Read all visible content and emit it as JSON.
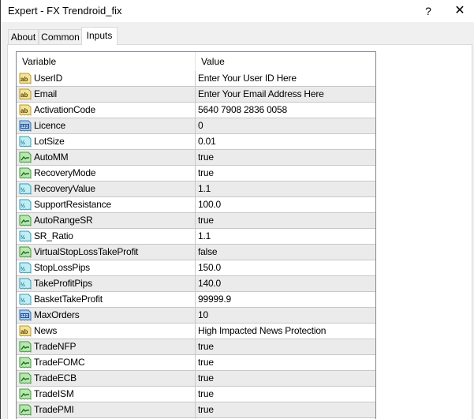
{
  "window": {
    "title": "Expert - FX Trendroid_fix",
    "help_label": "?",
    "close_label": "✕"
  },
  "tabs": [
    {
      "label": "About",
      "active": false
    },
    {
      "label": "Common",
      "active": false
    },
    {
      "label": "Inputs",
      "active": true
    }
  ],
  "grid": {
    "columns": {
      "variable": "Variable",
      "value": "Value"
    },
    "rows": [
      {
        "icon": "string-icon",
        "variable": "UserID",
        "value": "Enter Your User ID Here"
      },
      {
        "icon": "string-icon",
        "variable": "Email",
        "value": "Enter Your Email Address Here"
      },
      {
        "icon": "string-icon",
        "variable": "ActivationCode",
        "value": "5640 7908 2836 0058"
      },
      {
        "icon": "integer-icon",
        "variable": "Licence",
        "value": "0"
      },
      {
        "icon": "double-icon",
        "variable": "LotSize",
        "value": "0.01"
      },
      {
        "icon": "bool-icon",
        "variable": "AutoMM",
        "value": "true"
      },
      {
        "icon": "bool-icon",
        "variable": "RecoveryMode",
        "value": "true"
      },
      {
        "icon": "double-icon",
        "variable": "RecoveryValue",
        "value": "1.1"
      },
      {
        "icon": "double-icon",
        "variable": "SupportResistance",
        "value": "100.0"
      },
      {
        "icon": "bool-icon",
        "variable": "AutoRangeSR",
        "value": "true"
      },
      {
        "icon": "double-icon",
        "variable": "SR_Ratio",
        "value": "1.1"
      },
      {
        "icon": "bool-icon",
        "variable": "VirtualStopLossTakeProfit",
        "value": "false"
      },
      {
        "icon": "double-icon",
        "variable": "StopLossPips",
        "value": "150.0"
      },
      {
        "icon": "double-icon",
        "variable": "TakeProfitPips",
        "value": "140.0"
      },
      {
        "icon": "double-icon",
        "variable": "BasketTakeProfit",
        "value": "99999.9"
      },
      {
        "icon": "integer-icon",
        "variable": "MaxOrders",
        "value": "10"
      },
      {
        "icon": "string-icon",
        "variable": "News",
        "value": "High Impacted News Protection"
      },
      {
        "icon": "bool-icon",
        "variable": "TradeNFP",
        "value": "true"
      },
      {
        "icon": "bool-icon",
        "variable": "TradeFOMC",
        "value": "true"
      },
      {
        "icon": "bool-icon",
        "variable": "TradeECB",
        "value": "true"
      },
      {
        "icon": "bool-icon",
        "variable": "TradeISM",
        "value": "true"
      },
      {
        "icon": "bool-icon",
        "variable": "TradePMI",
        "value": "true"
      }
    ]
  },
  "icon_glyphs": {
    "string-icon": "ab",
    "integer-icon": "123",
    "double-icon": "½",
    "bool-icon": "⌐"
  }
}
